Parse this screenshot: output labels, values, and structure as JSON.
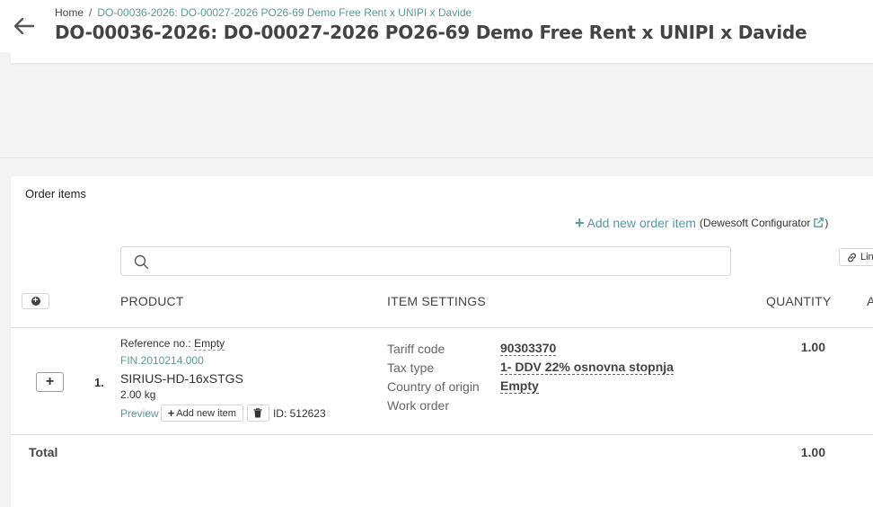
{
  "header": {
    "breadcrumb": [
      "Home",
      "DO-00036-2026: DO-00027-2026 PO26-69 Demo Free Rent x UNIPI x Davide"
    ],
    "separator": "/",
    "title": "DO-00036-2026: DO-00027-2026 PO26-69 Demo Free Rent x UNIPI x Davide"
  },
  "order_items": {
    "title": "Order items",
    "add_new_order_item": "Add new order item",
    "configurator_note": "(Dewesoft Configurator",
    "configurator_close": ")",
    "search_placeholder": "",
    "link_button": "Lin",
    "columns": {
      "product": "PRODUCT",
      "item_settings": "ITEM SETTINGS",
      "quantity": "QUANTITY",
      "amount": "A"
    },
    "items": [
      {
        "number": "1.",
        "reference_label": "Reference no.:",
        "reference_value": "Empty",
        "code": "FIN.2010214.000",
        "name": "SIRIUS-HD-16xSTGS",
        "weight": "2.00 kg",
        "preview": "Preview",
        "add_new_item": "Add new item",
        "id_text": "ID: 512623",
        "settings": [
          {
            "label": "Tariff code",
            "value": "90303370"
          },
          {
            "label": "Tax type",
            "value": "1- DDV 22% osnovna stopnja"
          },
          {
            "label": "Country of origin",
            "value": "Empty"
          },
          {
            "label": "Work order",
            "value": ""
          }
        ],
        "quantity": "1.00"
      }
    ],
    "total_label": "Total",
    "total_quantity": "1.00"
  },
  "colors": {
    "accent": "#5a9a98",
    "text": "#333333"
  }
}
